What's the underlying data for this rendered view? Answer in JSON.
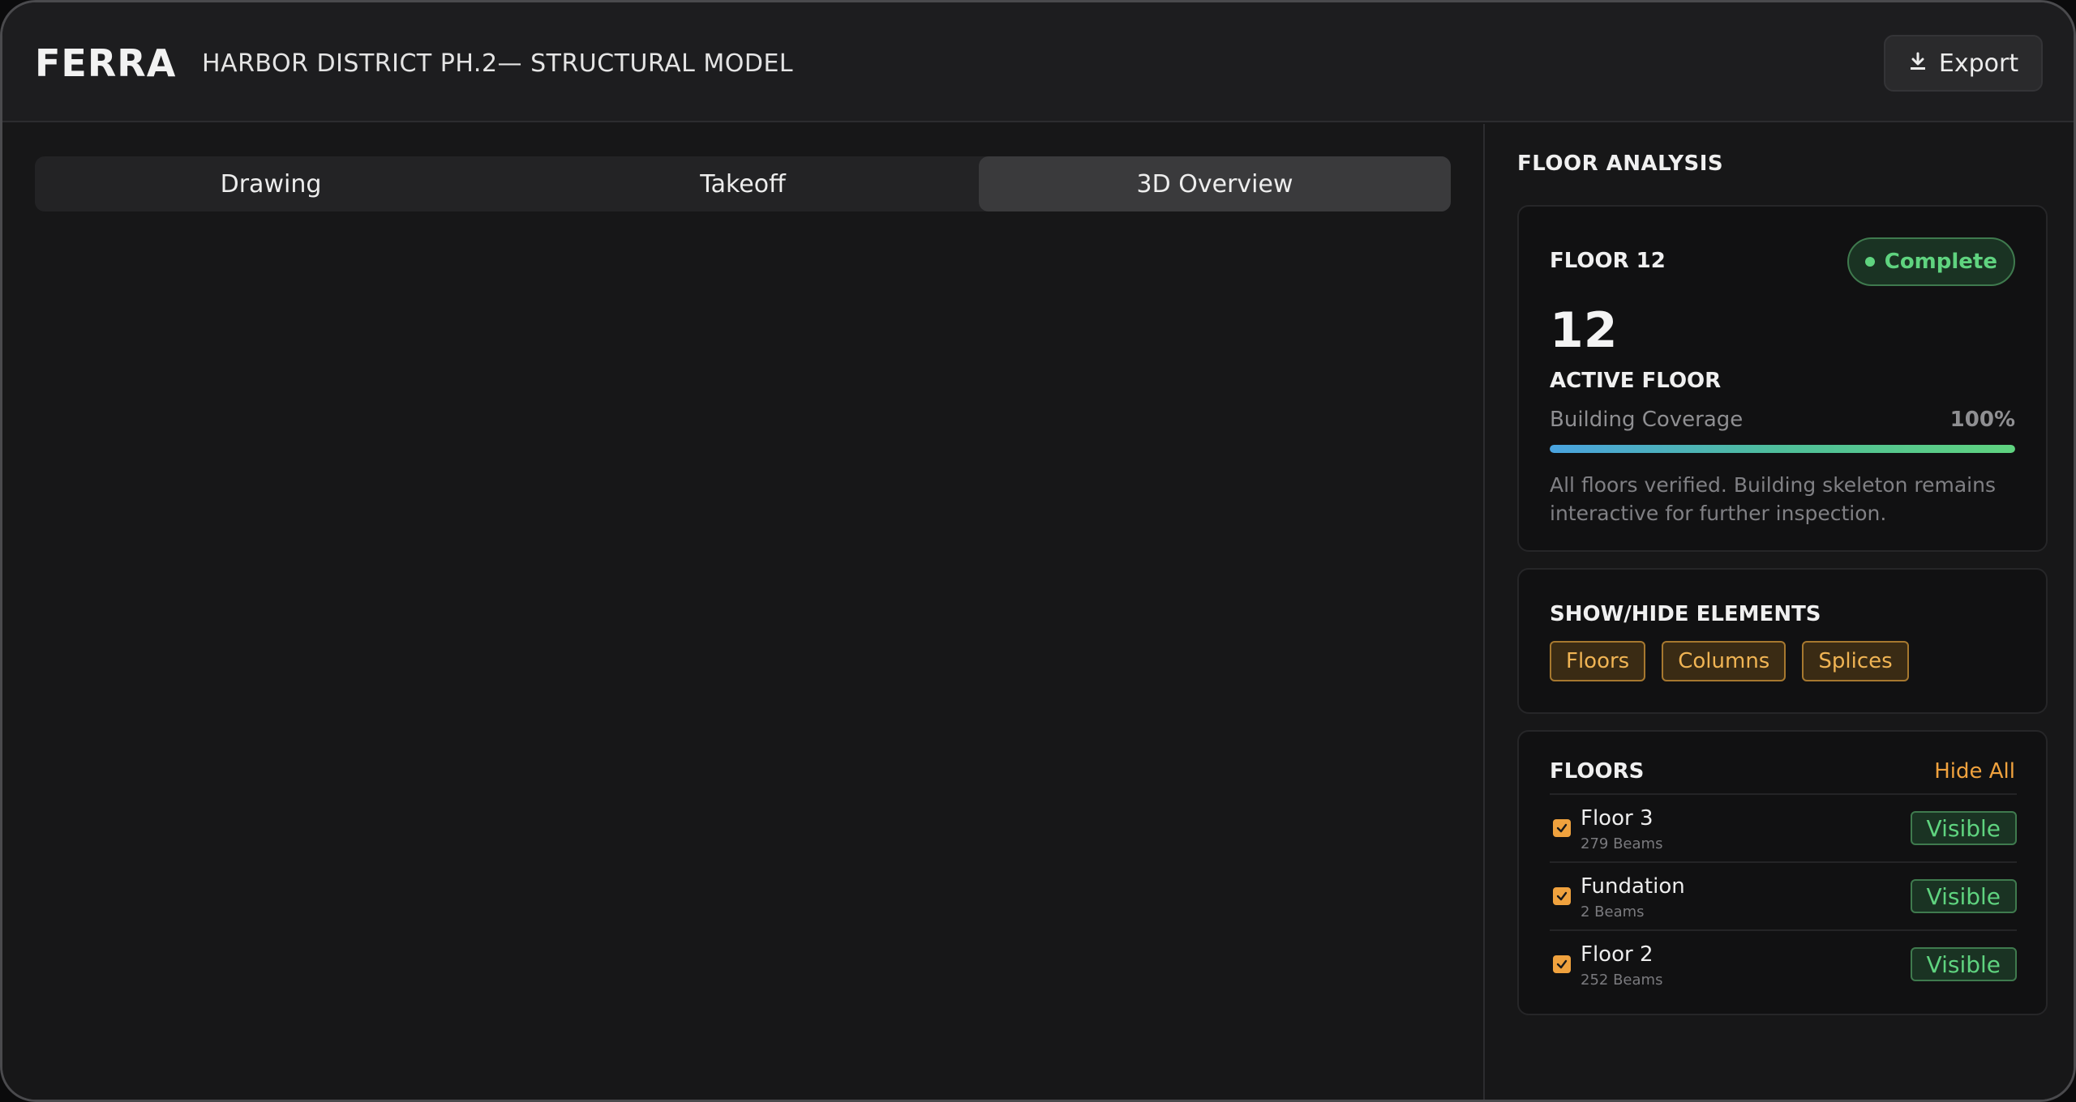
{
  "header": {
    "brand": "FERRA",
    "project_title": "HARBOR DISTRICT PH.2— STRUCTURAL MODEL",
    "export_label": "Export",
    "export_icon": "download-icon"
  },
  "tabs": [
    {
      "label": "Drawing",
      "active": false
    },
    {
      "label": "Takeoff",
      "active": false
    },
    {
      "label": "3D Overview",
      "active": true
    }
  ],
  "sidebar": {
    "title": "FLOOR ANALYSIS",
    "analysis": {
      "floor_label": "FLOOR 12",
      "status": "Complete",
      "floor_number": "12",
      "active_label": "ACTIVE FLOOR",
      "coverage_label": "Building Coverage",
      "coverage_value": "100%",
      "coverage_fraction": 1.0,
      "note": "All floors verified. Building skeleton remains interactive for further inspection."
    },
    "toggles": {
      "heading": "SHOW/HIDE ELEMENTS",
      "chips": [
        "Floors",
        "Columns",
        "Splices"
      ]
    },
    "floors": {
      "heading": "FLOORS",
      "hide_all": "Hide All",
      "items": [
        {
          "name": "Floor 3",
          "beams": "279 Beams",
          "status": "Visible",
          "checked": true
        },
        {
          "name": "Fundation",
          "beams": "2 Beams",
          "status": "Visible",
          "checked": true
        },
        {
          "name": "Floor 2",
          "beams": "252 Beams",
          "status": "Visible",
          "checked": true
        }
      ]
    }
  },
  "colors": {
    "accent": "#f0a23e",
    "success": "#5fd37f",
    "progress_start": "#4aa3e0",
    "progress_end": "#5fd37f"
  }
}
